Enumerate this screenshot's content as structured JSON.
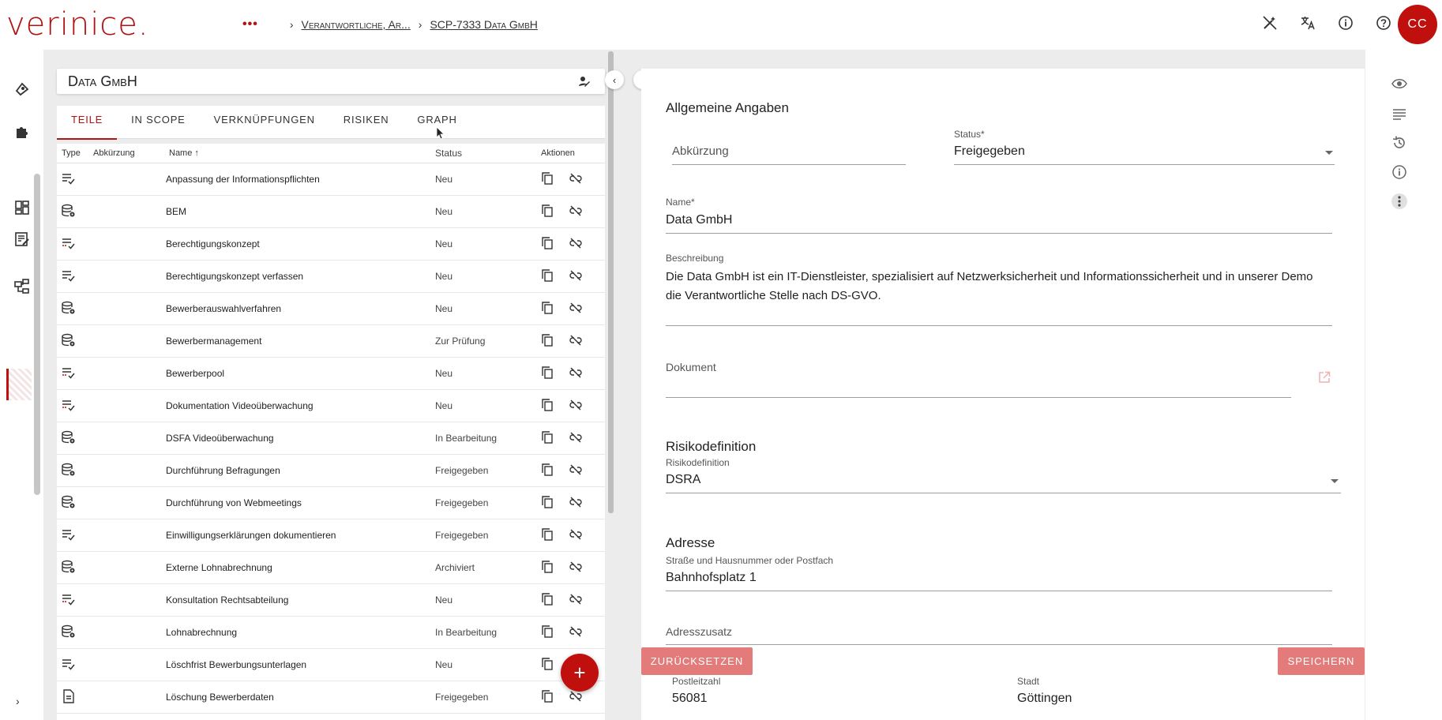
{
  "app": {
    "logo": "verinice.",
    "avatar_initials": "CC",
    "accent": "#c0100e"
  },
  "breadcrumb": {
    "more": "•••",
    "items": [
      "Verantwortliche, Ar...",
      "SCP-7333 Data GmbH"
    ]
  },
  "top_icons": [
    "magic-off-icon",
    "translate-icon",
    "info-icon",
    "help-icon"
  ],
  "left_rail_icons": [
    "rocket-icon",
    "puzzle-icon",
    "dashboard-icon",
    "report-icon",
    "hierarchy-icon"
  ],
  "left_panel": {
    "title": "Data GmbH",
    "tabs": [
      "TEILE",
      "IN SCOPE",
      "VERKNÜPFUNGEN",
      "RISIKEN",
      "GRAPH"
    ],
    "active_tab": "TEILE",
    "columns": {
      "type": "Type",
      "abk": "Abkürzung",
      "name": "Name",
      "status": "Status",
      "actions": "Aktionen"
    },
    "sort_indicator": "↑",
    "rows": [
      {
        "type": "list-check",
        "name": "Anpassung der Informationspflichten",
        "status": "Neu"
      },
      {
        "type": "database-gear",
        "name": "BEM",
        "status": "Neu"
      },
      {
        "type": "list-check-red",
        "name": "Berechtigungskonzept",
        "status": "Neu"
      },
      {
        "type": "list-check",
        "name": "Berechtigungskonzept verfassen",
        "status": "Neu"
      },
      {
        "type": "database-gear",
        "name": "Bewerberauswahlverfahren",
        "status": "Neu"
      },
      {
        "type": "database-gear",
        "name": "Bewerbermanagement",
        "status": "Zur Prüfung"
      },
      {
        "type": "list-check-red",
        "name": "Bewerberpool",
        "status": "Neu"
      },
      {
        "type": "list-check-red",
        "name": "Dokumentation Videoüberwachung",
        "status": "Neu"
      },
      {
        "type": "database-gear",
        "name": "DSFA Videoüberwachung",
        "status": "In Bearbeitung"
      },
      {
        "type": "database-gear",
        "name": "Durchführung Befragungen",
        "status": "Freigegeben"
      },
      {
        "type": "database-gear",
        "name": "Durchführung von Webmeetings",
        "status": "Freigegeben"
      },
      {
        "type": "list-check",
        "name": "Einwilligungserklärungen dokumentieren",
        "status": "Freigegeben"
      },
      {
        "type": "database-gear",
        "name": "Externe Lohnabrechnung",
        "status": "Archiviert"
      },
      {
        "type": "list-check-red",
        "name": "Konsultation Rechtsabteilung",
        "status": "Neu"
      },
      {
        "type": "database-gear",
        "name": "Lohnabrechnung",
        "status": "In Bearbeitung"
      },
      {
        "type": "list-check",
        "name": "Löschfrist Bewerbungsunterlagen",
        "status": "Neu"
      },
      {
        "type": "document",
        "name": "Löschung Bewerberdaten",
        "status": "Freigegeben"
      }
    ],
    "fab_label": "+"
  },
  "form": {
    "general_title": "Allgemeine Angaben",
    "abk_placeholder": "Abkürzung",
    "status_label": "Status*",
    "status_value": "Freigegeben",
    "name_label": "Name*",
    "name_value": "Data GmbH",
    "desc_label": "Beschreibung",
    "desc_value": "Die Data GmbH ist ein IT-Dienstleister, spezialisiert auf Netzwerksicherheit und Informationssicherheit und in unserer Demo die Verantwortliche Stelle nach DS-GVO.",
    "doc_label": "Dokument",
    "risk_title": "Risikodefinition",
    "risk_label": "Risikodefinition",
    "risk_value": "DSRA",
    "address_title": "Adresse",
    "street_label": "Straße und Hausnummer oder Postfach",
    "street_value": "Bahnhofsplatz 1",
    "addr2_placeholder": "Adresszusatz",
    "zip_label": "Postleitzahl",
    "zip_value": "56081",
    "city_label": "Stadt",
    "city_value": "Göttingen",
    "reset_label": "ZURÜCKSETZEN",
    "save_label": "SPEICHERN"
  },
  "right_rail_icons": [
    "eye-icon",
    "list-icon",
    "history-icon",
    "info-icon",
    "more-vert-icon"
  ]
}
